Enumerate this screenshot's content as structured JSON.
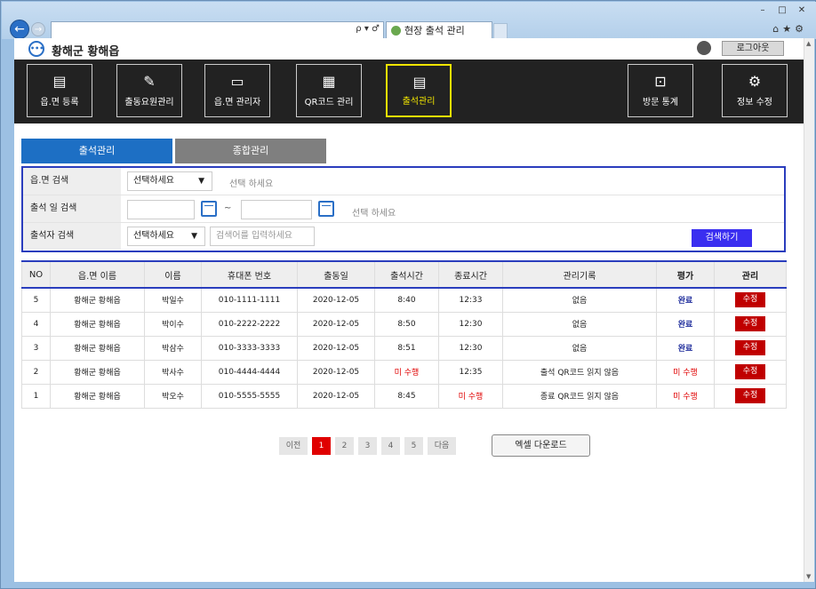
{
  "browser": {
    "tab_title": "현장 출석 관리",
    "addr_tools": "ρ ▾ ♂"
  },
  "header": {
    "site_title": "황해군 황해읍",
    "logout_label": "로그아웃"
  },
  "menu": [
    {
      "label": "읍.면 등록",
      "icon": "register-doc-icon"
    },
    {
      "label": "출동요원관리",
      "icon": "pencil-icon"
    },
    {
      "label": "읍.면 관리자",
      "icon": "admin-card-icon"
    },
    {
      "label": "QR코드 관리",
      "icon": "qr-code-icon"
    },
    {
      "label": "출석관리",
      "icon": "attendance-doc-icon"
    },
    {
      "label": "방문 통계",
      "icon": "presentation-icon"
    },
    {
      "label": "정보 수정",
      "icon": "gear-icon"
    }
  ],
  "subtabs": {
    "attendance": "출석관리",
    "summary": "종합관리"
  },
  "search": {
    "row1_label": "읍.면 검색",
    "row1_select": "선택하세요",
    "row1_hint": "선택 하세요",
    "row2_label": "출석 일 검색",
    "row2_tilde": "~",
    "row2_hint": "선택 하세요",
    "row3_label": "출석자 검색",
    "row3_select": "선택하세요",
    "row3_placeholder": "검색어를 입력하세요",
    "button": "검색하기"
  },
  "table": {
    "headers": [
      "NO",
      "읍.면 이름",
      "이름",
      "휴대폰 번호",
      "출동일",
      "출석시간",
      "종료시간",
      "관리기록",
      "평가",
      "관리"
    ],
    "edit_label": "수정",
    "rows": [
      {
        "no": "5",
        "town": "황해군 황해읍",
        "name": "박일수",
        "phone": "010-1111-1111",
        "date": "2020-12-05",
        "start": "8:40",
        "end": "12:33",
        "record": "없음",
        "eval": "완료"
      },
      {
        "no": "4",
        "town": "황해군 황해읍",
        "name": "박이수",
        "phone": "010-2222-2222",
        "date": "2020-12-05",
        "start": "8:50",
        "end": "12:30",
        "record": "없음",
        "eval": "완료"
      },
      {
        "no": "3",
        "town": "황해군 황해읍",
        "name": "박삼수",
        "phone": "010-3333-3333",
        "date": "2020-12-05",
        "start": "8:51",
        "end": "12:30",
        "record": "없음",
        "eval": "완료"
      },
      {
        "no": "2",
        "town": "황해군 황해읍",
        "name": "박사수",
        "phone": "010-4444-4444",
        "date": "2020-12-05",
        "start": "미 수행",
        "end": "12:35",
        "record": "출석 QR코드 읽지 않음",
        "eval": "미 수행"
      },
      {
        "no": "1",
        "town": "황해군 황해읍",
        "name": "박오수",
        "phone": "010-5555-5555",
        "date": "2020-12-05",
        "start": "8:45",
        "end": "미 수행",
        "record": "종료 QR코드 읽지 않음",
        "eval": "미 수행"
      }
    ]
  },
  "pagination": {
    "prev": "이전",
    "pages": [
      "1",
      "2",
      "3",
      "4",
      "5"
    ],
    "current": "1",
    "next": "다음",
    "excel": "엑셀 다운로드"
  },
  "colors": {
    "primary_blue": "#1d6fc4",
    "search_border": "#2a3dbd",
    "alert_red": "#e00000",
    "active_menu": "#f2e600"
  }
}
